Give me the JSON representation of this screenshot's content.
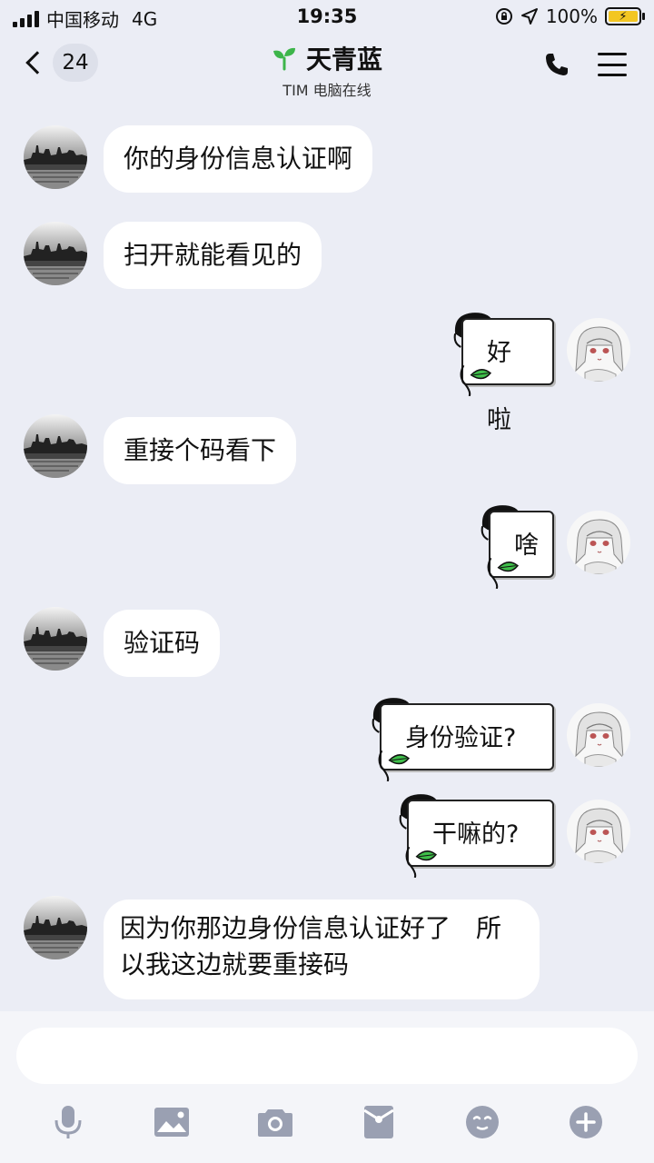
{
  "status_bar": {
    "carrier": "中国移动",
    "network": "4G",
    "time": "19:35",
    "battery": "100%"
  },
  "nav": {
    "back_count": "24",
    "title": "天青蓝",
    "subtitle": "TIM 电脑在线"
  },
  "messages": [
    {
      "from": "other",
      "text": "你的身份信息认证啊"
    },
    {
      "from": "other",
      "text": "扫开就能看见的"
    },
    {
      "from": "me",
      "text": "好啦"
    },
    {
      "from": "other",
      "text": "重接个码看下"
    },
    {
      "from": "me",
      "text": "啥"
    },
    {
      "from": "other",
      "text": "验证码"
    },
    {
      "from": "me",
      "text": "身份验证?"
    },
    {
      "from": "me",
      "text": "干嘛的?"
    },
    {
      "from": "other",
      "line1": "因为你那边身份信息认证好了　所",
      "line2": "以我这边就要重接码"
    }
  ],
  "toolbar": {
    "icons": [
      "microphone-icon",
      "image-icon",
      "camera-icon",
      "red-packet-icon",
      "emoji-icon",
      "plus-icon"
    ]
  },
  "colors": {
    "background": "#ebedf5",
    "bubble": "#ffffff",
    "toolbar_icon": "#9aa0b2",
    "sprout": "#3db54a",
    "battery": "#f3c622"
  }
}
